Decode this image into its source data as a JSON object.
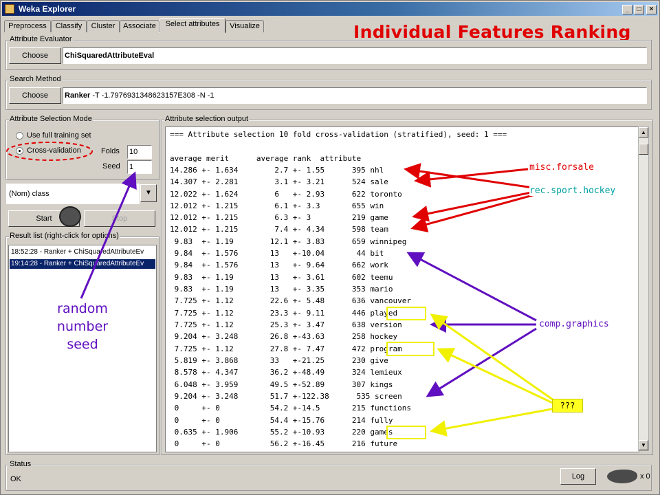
{
  "window": {
    "title": "Weka Explorer"
  },
  "tabs": [
    "Preprocess",
    "Classify",
    "Cluster",
    "Associate",
    "Select attributes",
    "Visualize"
  ],
  "active_tab": "Select attributes",
  "headline": "Individual Features Ranking",
  "evaluator": {
    "group_label": "Attribute Evaluator",
    "choose_label": "Choose",
    "name": "ChiSquaredAttributeEval",
    "options": ""
  },
  "search": {
    "group_label": "Search Method",
    "choose_label": "Choose",
    "name": "Ranker",
    "options": " -T -1.7976931348623157E308 -N -1"
  },
  "mode": {
    "group_label": "Attribute Selection Mode",
    "full_training": "Use full training set",
    "cross_validation": "Cross-validation",
    "folds_label": "Folds",
    "folds_value": "10",
    "seed_label": "Seed",
    "seed_value": "1"
  },
  "class_select": "(Nom) class",
  "start_label": "Start",
  "stop_label": "Stop",
  "results": {
    "group_label": "Result list (right-click for options)",
    "items": [
      "18:52:28 - Ranker + ChiSquaredAttributeEv",
      "19:14:28 - Ranker + ChiSquaredAttributeEv"
    ]
  },
  "output": {
    "group_label": "Attribute selection output",
    "lines": [
      "=== Attribute selection 10 fold cross-validation (stratified), seed: 1 ===",
      "",
      "average merit      average rank  attribute",
      "14.286 +- 1.634        2.7 +- 1.55      395 nhl",
      "14.307 +- 2.281        3.1 +- 3.21      524 sale",
      "12.022 +- 1.624        6   +- 2.93      622 toronto",
      "12.012 +- 1.215        6.1 +- 3.3       655 win",
      "12.012 +- 1.215        6.3 +- 3         219 game",
      "12.012 +- 1.215        7.4 +- 4.34      598 team",
      " 9.83  +- 1.19        12.1 +- 3.83      659 winnipeg",
      " 9.84  +- 1.576       13   +-10.04       44 bit",
      " 9.84  +- 1.576       13   +- 9.64      662 work",
      " 9.83  +- 1.19        13   +- 3.61      602 teemu",
      " 9.83  +- 1.19        13   +- 3.35      353 mario",
      " 7.725 +- 1.12        22.6 +- 5.48      636 vancouver",
      " 7.725 +- 1.12        23.3 +- 9.11      446 played",
      " 7.725 +- 1.12        25.3 +- 3.47      638 version",
      " 9.204 +- 3.248       26.8 +-43.63      258 hockey",
      " 7.725 +- 1.12        27.8 +- 7.47      472 program",
      " 5.819 +- 3.868       33   +-21.25      230 give",
      " 8.578 +- 4.347       36.2 +-48.49      324 lemieux",
      " 6.048 +- 3.959       49.5 +-52.89      307 kings",
      " 9.204 +- 3.248       51.7 +-122.38      535 screen",
      " 0     +- 0           54.2 +-14.5       215 functions",
      " 0     +- 0           54.4 +-15.76      214 fully",
      " 0.635 +- 1.906       55.2 +-10.93      220 games",
      " 0     +- 0           56.2 +-16.45      216 future"
    ]
  },
  "annotations": {
    "misc_forsale": "misc.forsale",
    "rec_sport_hockey": "rec.sport.hockey",
    "comp_graphics": "comp.graphics",
    "unknown": "???",
    "seed_note_1": "random",
    "seed_note_2": "number",
    "seed_note_3": "seed"
  },
  "status": {
    "group_label": "Status",
    "text": "OK",
    "log_label": "Log",
    "count": "x 0"
  },
  "colors": {
    "red": "#e00000",
    "purple": "#6010c0",
    "yellow": "#f0f000",
    "selection": "#0a246a"
  }
}
